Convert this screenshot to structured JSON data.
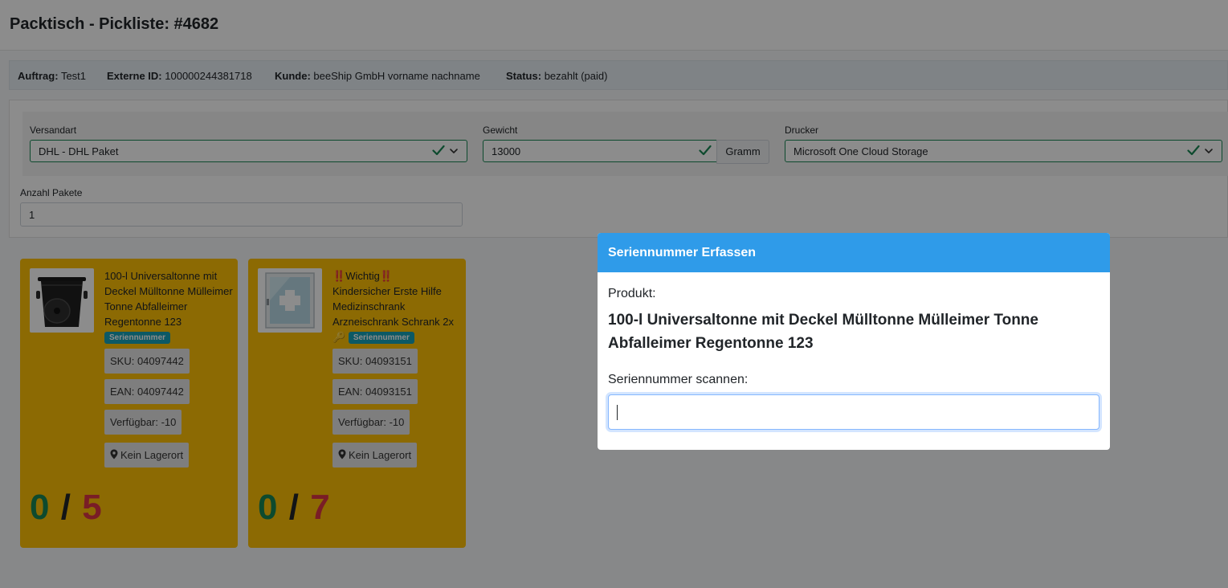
{
  "header": {
    "title": "Packtisch - Pickliste: #4682"
  },
  "order_info": [
    {
      "label": "Auftrag:",
      "value": "Test1"
    },
    {
      "label": "Externe ID:",
      "value": "100000244381718"
    },
    {
      "label": "Kunde:",
      "value": "beeShip GmbH vorname nachname"
    },
    {
      "label": "Status:",
      "value": "bezahlt (paid)"
    }
  ],
  "form": {
    "shipping_label": "Versandart",
    "shipping_value": "DHL - DHL Paket",
    "weight_label": "Gewicht",
    "weight_value": "13000",
    "weight_unit": "Gramm",
    "printer_label": "Drucker",
    "printer_value": "Microsoft One Cloud Storage",
    "packages_label": "Anzahl Pakete",
    "packages_value": "1"
  },
  "products": [
    {
      "name": "100-l Universaltonne mit Deckel Mülltonne Mülleimer Tonne Abfalleimer Regentonne 123",
      "badge": "Seriennummer",
      "sku": "SKU: 04097442",
      "ean": "EAN: 04097442",
      "available": "Verfügbar: -10",
      "location": "Kein Lagerort",
      "picked": "0",
      "separator": "/",
      "total": "5",
      "image_icon": "trash-bin-image"
    },
    {
      "warning_prefix": "‼️",
      "warning_word": "Wichtig",
      "warning_suffix": "‼️",
      "name": "Kindersicher Erste Hilfe Medizinschrank Arzneischrank Schrank 2x",
      "name_emoji": "🔑",
      "badge": "Seriennummer",
      "sku": "SKU: 04093151",
      "ean": "EAN: 04093151",
      "available": "Verfügbar: -10",
      "location": "Kein Lagerort",
      "picked": "0",
      "separator": "/",
      "total": "7",
      "image_icon": "medicine-cabinet-image"
    }
  ],
  "modal": {
    "title": "Seriennummer Erfassen",
    "product_label": "Produkt:",
    "product_name": "100-l Universaltonne mit Deckel Mülltonne Mülleimer Tonne Abfalleimer Regentonne 123",
    "scan_label": "Seriennummer scannen:",
    "scan_value": ""
  },
  "colors": {
    "modal_header": "#2f9be9",
    "card_background": "#ffc107",
    "valid_border": "#198754",
    "picked_count": "#198754",
    "total_count": "#dc3545",
    "badge": "#17a2b8"
  }
}
